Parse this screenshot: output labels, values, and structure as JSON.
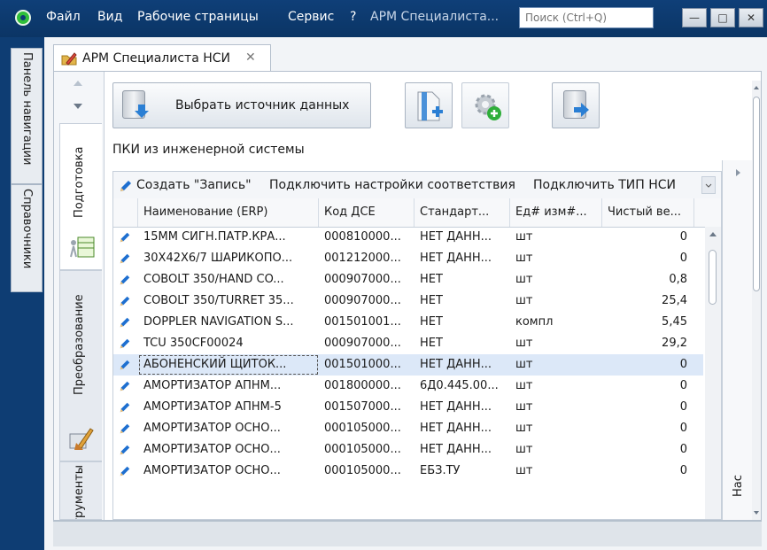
{
  "menu": {
    "file": "Файл",
    "view": "Вид",
    "workspaces": "Рабочие страницы",
    "service": "Сервис",
    "help": "?",
    "workspace_title": "АРМ Специалиста..."
  },
  "search": {
    "placeholder": "Поиск (Ctrl+Q)"
  },
  "window_buttons": {
    "minimize": "—",
    "maximize": "□",
    "close": "✕"
  },
  "left_tabs": {
    "nav_panel": "Панель навигации",
    "references": "Справочники"
  },
  "document_tab": {
    "label": "АРМ Специалиста НСИ",
    "close": "✕"
  },
  "side_tabs": {
    "preparation": "Подготовка",
    "transform": "Преобразование",
    "tools": "Инструменты"
  },
  "toolbar": {
    "select_source": "Выбрать источник данных"
  },
  "section_title": "ПКИ из инженерной системы",
  "grid_toolbar": {
    "create_record": "Создать \"Запись\"",
    "connect_mapping": "Подключить настройки соответствия",
    "connect_type": "Подключить ТИП НСИ"
  },
  "columns": [
    "Наименование (ERP)",
    "Код ДСЕ",
    "Стандарт...",
    "Ед# изм#...",
    "Чистый ве..."
  ],
  "rows": [
    [
      "15ММ СИГН.ПАТР.КРА...",
      "000810000...",
      "НЕТ ДАНН...",
      "шт",
      "0"
    ],
    [
      "30Х42Х6/7 ШАРИКОПО...",
      "001212000...",
      "НЕТ ДАНН...",
      "шт",
      "0"
    ],
    [
      "COBOLT 350/HAND CO...",
      "000907000...",
      "НЕТ",
      "шт",
      "0,8"
    ],
    [
      "COBOLT 350/TURRET 35...",
      "000907000...",
      "НЕТ",
      "шт",
      "25,4"
    ],
    [
      "DOPPLER NAVIGATION S...",
      "001501001...",
      "НЕТ",
      "компл",
      "5,45"
    ],
    [
      "TCU 350CF00024",
      "000907000...",
      "НЕТ",
      "шт",
      "29,2"
    ],
    [
      "АБОНЕНСКИЙ ЩИТОК...",
      "001501000...",
      "НЕТ ДАНН...",
      "шт",
      "0"
    ],
    [
      "АМОРТИЗАТОР АПНМ...",
      "001800000...",
      "6Д0.445.00...",
      "шт",
      "0"
    ],
    [
      "АМОРТИЗАТОР АПНМ-5",
      "001507000...",
      "НЕТ ДАНН...",
      "шт",
      "0"
    ],
    [
      "АМОРТИЗАТОР ОСНО...",
      "000105000...",
      "НЕТ ДАНН...",
      "шт",
      "0"
    ],
    [
      "АМОРТИЗАТОР ОСНО...",
      "000105000...",
      "НЕТ ДАНН...",
      "шт",
      "0"
    ],
    [
      "АМОРТИЗАТОР ОСНО...",
      "000105000...",
      "ЕБЗ.ТУ",
      "шт",
      "0"
    ]
  ],
  "selected_row": 6,
  "right_panel_label": "Нас",
  "colors": {
    "title_bg": "#0e3d73",
    "accent": "#1e6fd0",
    "selection": "#dce8f8"
  }
}
